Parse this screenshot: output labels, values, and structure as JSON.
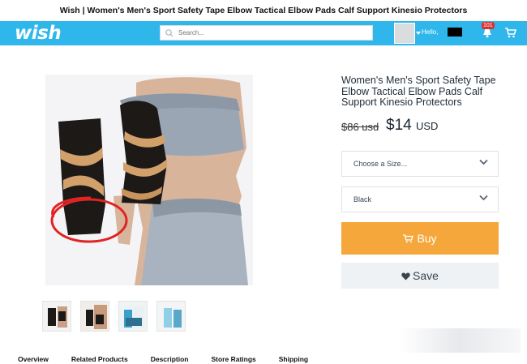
{
  "window": {
    "title": "Wish | Women's Men's Sport Safety Tape Elbow Tactical Elbow Pads Calf Support Kinesio Protectors"
  },
  "header": {
    "logo": "wish",
    "search_placeholder": "Search...",
    "greeting": "Hello,",
    "notification_count": "101",
    "accent_color": "#2fb7ec"
  },
  "product": {
    "title": "Women's Men's Sport Safety Tape Elbow Tactical Elbow Pads Calf Support Kinesio Protectors",
    "old_price": "$86 usd",
    "price": "$14",
    "currency": "USD",
    "size_select": "Choose a Size...",
    "color_select": "Black",
    "buy_label": "Buy",
    "save_label": "Save",
    "buy_color": "#f5a73c"
  },
  "tabs": [
    "Overview",
    "Related Products",
    "Description",
    "Store Ratings",
    "Shipping"
  ]
}
